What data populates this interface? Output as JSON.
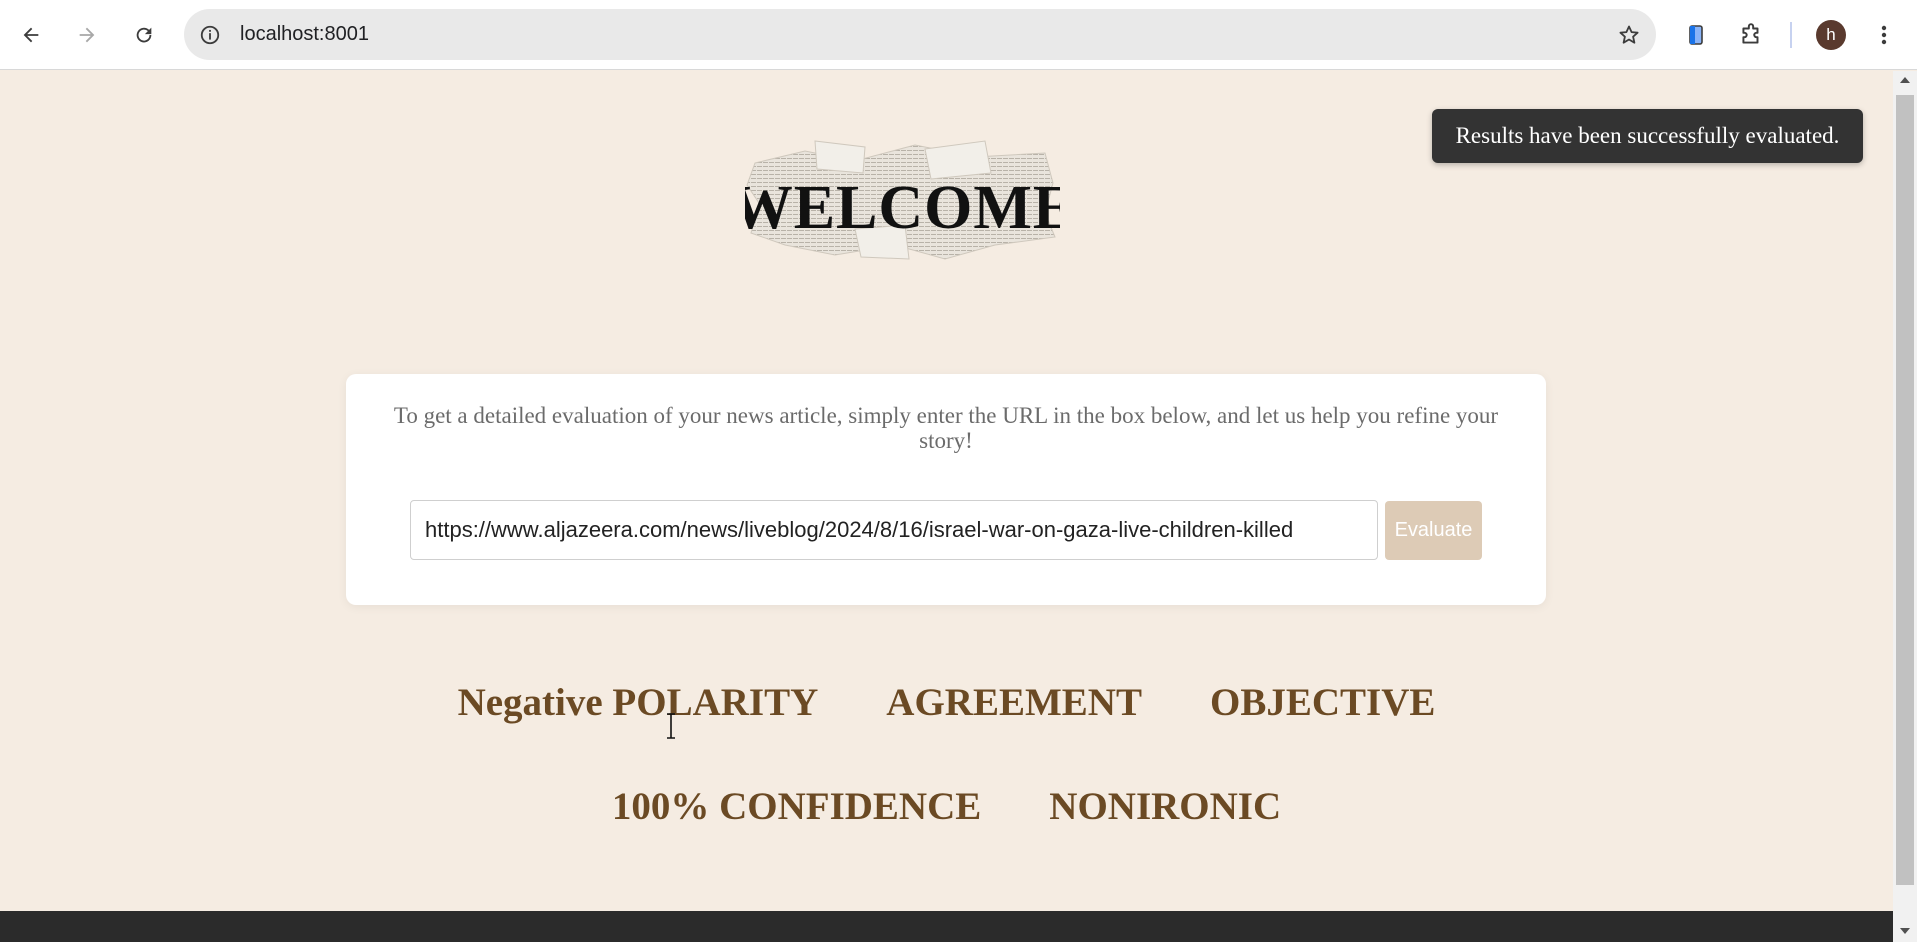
{
  "browser": {
    "url": "localhost:8001",
    "avatar_letter": "h"
  },
  "toast": {
    "message": "Results have been successfully evaluated."
  },
  "card": {
    "intro": "To get a detailed evaluation of your news article, simply enter the URL in the box below, and let us help you refine your story!",
    "url_value": "https://www.aljazeera.com/news/liveblog/2024/8/16/israel-war-on-gaza-live-children-killed",
    "evaluate_label": "Evaluate"
  },
  "logo": {
    "text": "WELCOME"
  },
  "results": {
    "polarity": "Negative POLARITY",
    "agreement": "AGREEMENT",
    "subjectivity": "OBJECTIVE",
    "confidence": "100% CONFIDENCE",
    "irony": "NONIRONIC"
  },
  "colors": {
    "page_bg": "#f5ece2",
    "result_text": "#6b4a24",
    "button_bg": "#ddcbb6",
    "toast_bg": "#333333",
    "footer_bg": "#2b2b2b"
  }
}
